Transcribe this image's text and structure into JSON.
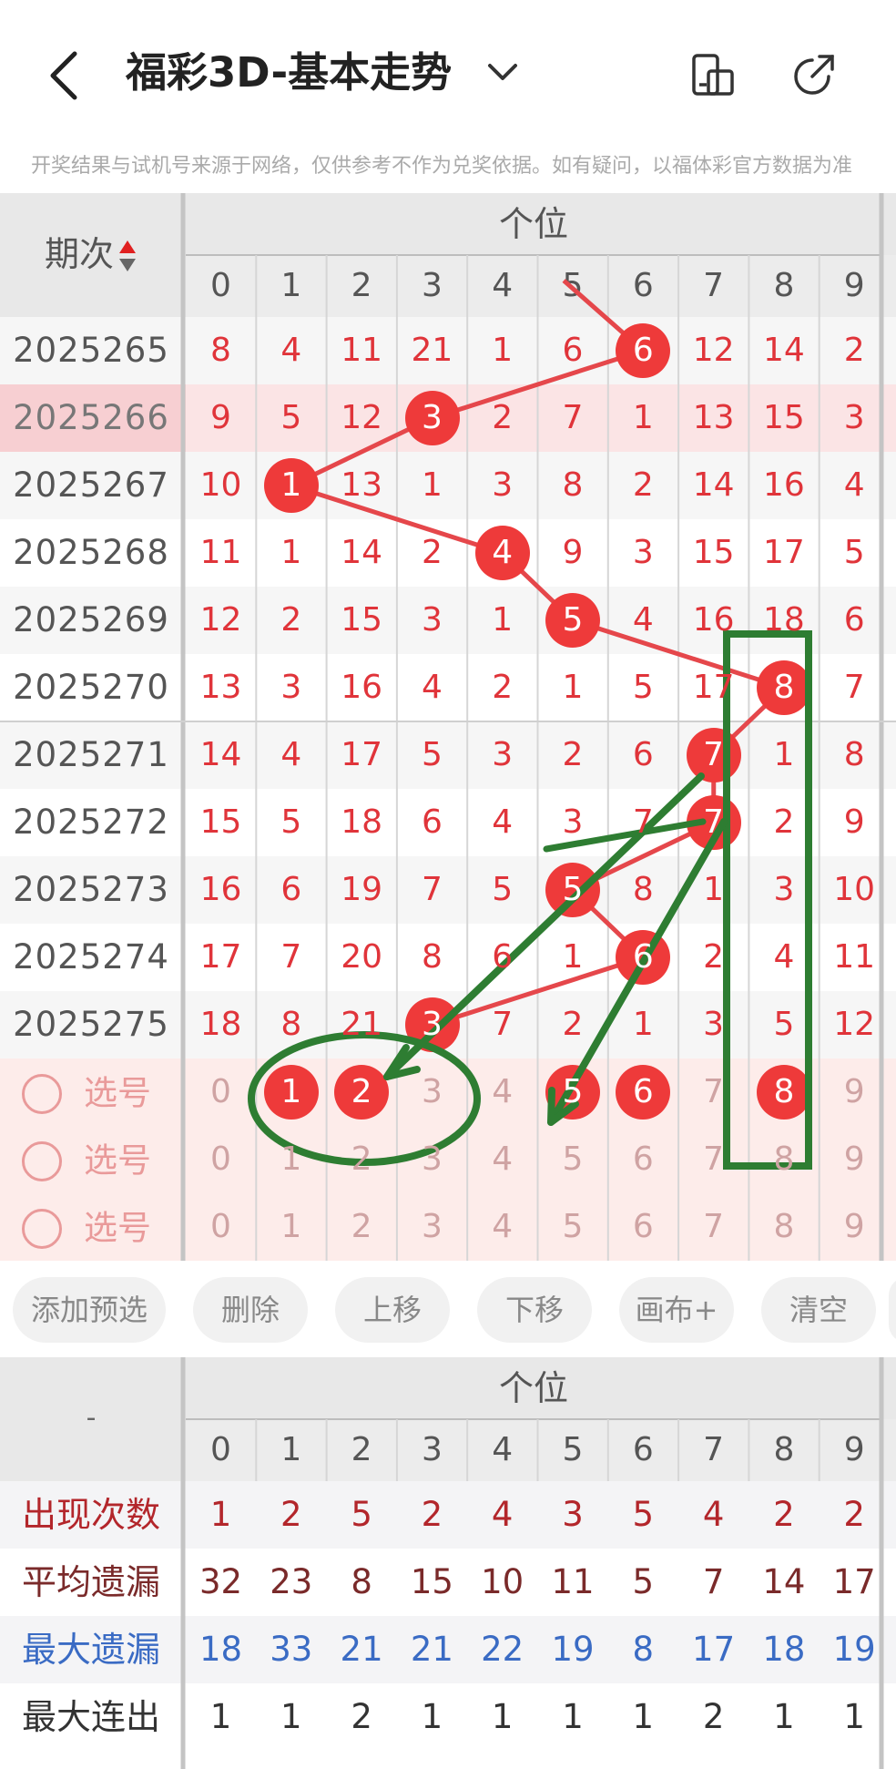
{
  "header": {
    "title": "福彩3D-基本走势",
    "icons": [
      "back-icon",
      "chevron-down-icon",
      "layout-icon",
      "share-icon"
    ]
  },
  "notice": "开奖结果与试机号来源于网络，仅供参考不作为兑奖依据。如有疑问，以福体彩官方数据为准",
  "table": {
    "column_group": "个位",
    "issue_header": "期次",
    "digits": [
      "0",
      "1",
      "2",
      "3",
      "4",
      "5",
      "6",
      "7",
      "8",
      "9"
    ],
    "rows": [
      {
        "issue": "2025265",
        "values": [
          "8",
          "4",
          "11",
          "21",
          "1",
          "6",
          "6",
          "12",
          "14",
          "2"
        ],
        "ball": 6
      },
      {
        "issue": "2025266",
        "values": [
          "9",
          "5",
          "12",
          "3",
          "2",
          "7",
          "1",
          "13",
          "15",
          "3"
        ],
        "ball": 3
      },
      {
        "issue": "2025267",
        "values": [
          "10",
          "1",
          "13",
          "1",
          "3",
          "8",
          "2",
          "14",
          "16",
          "4"
        ],
        "ball": 1
      },
      {
        "issue": "2025268",
        "values": [
          "11",
          "1",
          "14",
          "2",
          "4",
          "9",
          "3",
          "15",
          "17",
          "5"
        ],
        "ball": 4
      },
      {
        "issue": "2025269",
        "values": [
          "12",
          "2",
          "15",
          "3",
          "1",
          "5",
          "4",
          "16",
          "18",
          "6"
        ],
        "ball": 5
      },
      {
        "issue": "2025270",
        "values": [
          "13",
          "3",
          "16",
          "4",
          "2",
          "1",
          "5",
          "17",
          "8",
          "7"
        ],
        "ball": 8
      },
      {
        "issue": "2025271",
        "values": [
          "14",
          "4",
          "17",
          "5",
          "3",
          "2",
          "6",
          "7",
          "1",
          "8"
        ],
        "ball": 7
      },
      {
        "issue": "2025272",
        "values": [
          "15",
          "5",
          "18",
          "6",
          "4",
          "3",
          "7",
          "7",
          "2",
          "9"
        ],
        "ball": 7
      },
      {
        "issue": "2025273",
        "values": [
          "16",
          "6",
          "19",
          "7",
          "5",
          "5",
          "8",
          "1",
          "3",
          "10"
        ],
        "ball": 5
      },
      {
        "issue": "2025274",
        "values": [
          "17",
          "7",
          "20",
          "8",
          "6",
          "1",
          "6",
          "2",
          "4",
          "11"
        ],
        "ball": 6
      },
      {
        "issue": "2025275",
        "values": [
          "18",
          "8",
          "21",
          "3",
          "7",
          "2",
          "1",
          "3",
          "5",
          "12"
        ],
        "ball": 3
      }
    ],
    "select_label": "选号",
    "select_rows": [
      {
        "selected": [
          1,
          2,
          5,
          6,
          8
        ]
      },
      {
        "selected": []
      },
      {
        "selected": []
      }
    ]
  },
  "toolbar": {
    "buttons": [
      "添加预选",
      "删除",
      "上移",
      "下移",
      "画布+",
      "清空"
    ]
  },
  "stats": {
    "column_group": "个位",
    "corner": "-",
    "digits": [
      "0",
      "1",
      "2",
      "3",
      "4",
      "5",
      "6",
      "7",
      "8",
      "9"
    ],
    "rows": [
      {
        "label": "出现次数",
        "values": [
          "1",
          "2",
          "5",
          "2",
          "4",
          "3",
          "5",
          "4",
          "2",
          "2"
        ],
        "color": "#b3262b"
      },
      {
        "label": "平均遗漏",
        "values": [
          "32",
          "23",
          "8",
          "15",
          "10",
          "11",
          "5",
          "7",
          "14",
          "17"
        ],
        "color": "#7a2a2a"
      },
      {
        "label": "最大遗漏",
        "values": [
          "18",
          "33",
          "21",
          "21",
          "22",
          "19",
          "8",
          "17",
          "18",
          "19"
        ],
        "color": "#3a6bc4"
      },
      {
        "label": "最大连出",
        "values": [
          "1",
          "1",
          "2",
          "1",
          "1",
          "1",
          "1",
          "2",
          "1",
          "1"
        ],
        "color": "#333333"
      }
    ]
  },
  "colors": {
    "accent": "#ee3a3a",
    "annotation": "#2e7d32",
    "highlight_row": "#f9d6d8",
    "select_bg": "#fdecea"
  }
}
